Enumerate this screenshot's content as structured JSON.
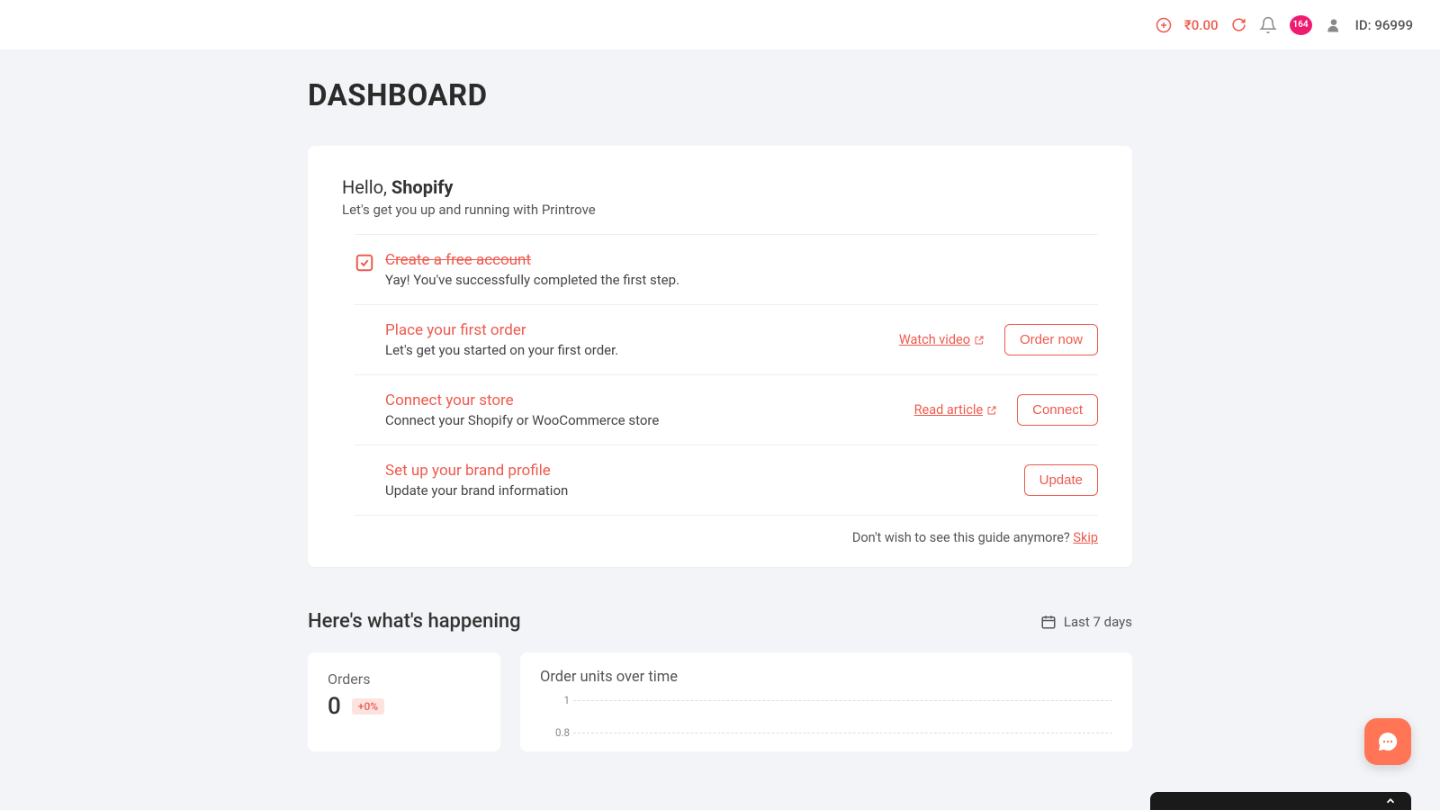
{
  "header": {
    "balance": "₹0.00",
    "badge_count": "164",
    "user_id": "ID: 96999"
  },
  "page_title": "DASHBOARD",
  "greeting": {
    "prefix": "Hello, ",
    "name": "Shopify",
    "subtitle": "Let's get you up and running with Printrove"
  },
  "steps": [
    {
      "title": "Create a free account",
      "desc": "Yay! You've successfully completed the first step.",
      "done": true,
      "link": null,
      "button": null
    },
    {
      "title": "Place your first order",
      "desc": "Let's get you started on your first order.",
      "done": false,
      "link": "Watch video",
      "button": "Order now"
    },
    {
      "title": "Connect your store",
      "desc": "Connect your Shopify or WooCommerce store",
      "done": false,
      "link": "Read article",
      "button": "Connect"
    },
    {
      "title": "Set up your brand profile",
      "desc": "Update your brand information",
      "done": false,
      "link": null,
      "button": "Update"
    }
  ],
  "skip": {
    "prompt": "Don't wish to see this guide anymore? ",
    "action": "Skip"
  },
  "happening": {
    "title": "Here's what's happening",
    "period": "Last 7 days"
  },
  "stat_card": {
    "label": "Orders",
    "value": "0",
    "delta": "+0%"
  },
  "chart": {
    "title": "Order units over time"
  },
  "chart_data": {
    "type": "line",
    "title": "Order units over time",
    "y_ticks": [
      "1",
      "0.8"
    ],
    "xlabel": "",
    "ylabel": "",
    "ylim": [
      0,
      1
    ],
    "series": [
      {
        "name": "Order units",
        "values": []
      }
    ]
  }
}
